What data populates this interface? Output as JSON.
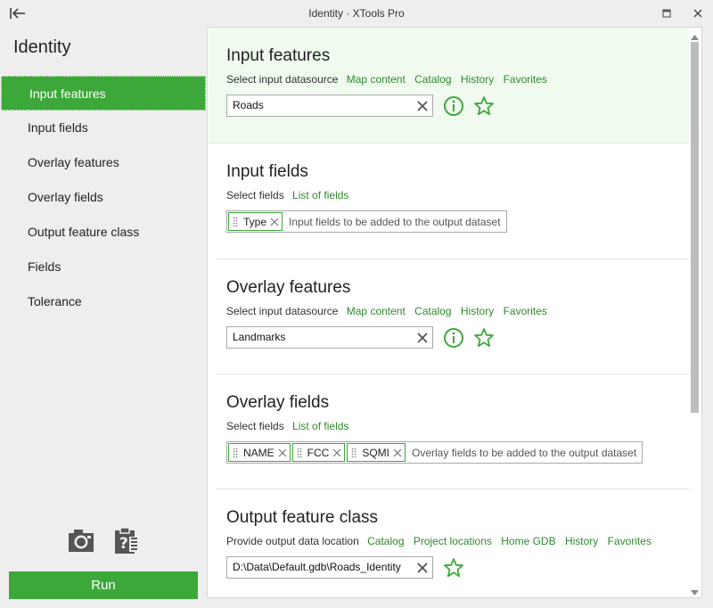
{
  "window": {
    "title": "Identity  ·  XTools Pro"
  },
  "nav": {
    "heading": "Identity",
    "items": [
      {
        "label": "Input features",
        "active": true
      },
      {
        "label": "Input fields"
      },
      {
        "label": "Overlay features"
      },
      {
        "label": "Overlay fields"
      },
      {
        "label": "Output feature class"
      },
      {
        "label": "Fields"
      },
      {
        "label": "Tolerance"
      }
    ],
    "run_label": "Run",
    "icons": [
      "camera-icon",
      "clipboard-help-icon"
    ]
  },
  "sections": {
    "input_features": {
      "title": "Input features",
      "prompt": "Select input datasource",
      "links": [
        "Map content",
        "Catalog",
        "History",
        "Favorites"
      ],
      "value": "Roads"
    },
    "input_fields": {
      "title": "Input fields",
      "prompt": "Select fields",
      "link": "List of fields",
      "tags": [
        "Type"
      ],
      "placeholder": "Input fields to be added to the output dataset"
    },
    "overlay_features": {
      "title": "Overlay features",
      "prompt": "Select input datasource",
      "links": [
        "Map content",
        "Catalog",
        "History",
        "Favorites"
      ],
      "value": "Landmarks"
    },
    "overlay_fields": {
      "title": "Overlay fields",
      "prompt": "Select fields",
      "link": "List of fields",
      "tags": [
        "NAME",
        "FCC",
        "SQMI"
      ],
      "placeholder": "Overlay fields to be added to the output dataset"
    },
    "output_feature_class": {
      "title": "Output feature class",
      "prompt": "Provide output data location",
      "links": [
        "Catalog",
        "Project locations",
        "Home GDB",
        "History",
        "Favorites"
      ],
      "value": "D:\\Data\\Default.gdb\\Roads_Identity"
    }
  },
  "colors": {
    "accent": "#3da83a",
    "link": "#2e8a2b",
    "active_section_bg": "#f0faef"
  }
}
